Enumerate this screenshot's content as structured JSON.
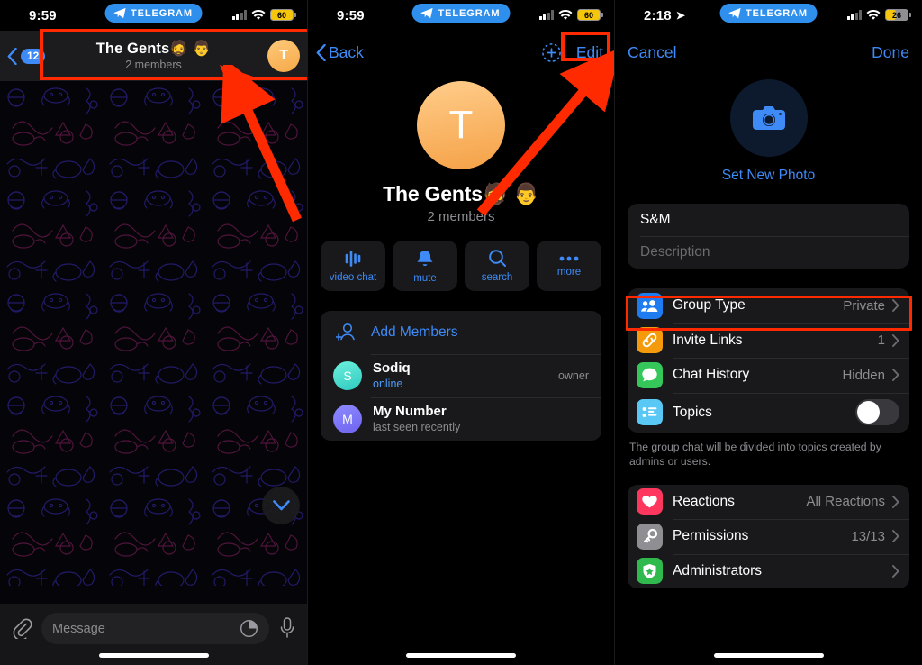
{
  "panel1": {
    "status": {
      "time": "9:59",
      "brand": "TELEGRAM",
      "battery": "60"
    },
    "nav": {
      "back_badge": "12",
      "title": "The Gents🧔 👨",
      "subtitle": "2 members",
      "avatar_letter": "T"
    },
    "composer": {
      "placeholder": "Message"
    }
  },
  "panel2": {
    "status": {
      "time": "9:59",
      "brand": "TELEGRAM",
      "battery": "60"
    },
    "nav": {
      "back_label": "Back",
      "edit_label": "Edit"
    },
    "profile": {
      "avatar_letter": "T",
      "name": "The Gents🧔 👨",
      "subtitle": "2 members"
    },
    "actions": [
      {
        "label": "video chat",
        "icon": "waveform-icon"
      },
      {
        "label": "mute",
        "icon": "bell-icon"
      },
      {
        "label": "search",
        "icon": "magnifier-icon"
      },
      {
        "label": "more",
        "icon": "ellipsis-icon"
      }
    ],
    "members": {
      "add_label": "Add Members",
      "list": [
        {
          "avatar_letter": "S",
          "name": "Sodiq",
          "status": "online",
          "role": "owner"
        },
        {
          "avatar_letter": "M",
          "name": "My Number",
          "status": "last seen recently",
          "role": ""
        }
      ]
    }
  },
  "panel3": {
    "status": {
      "time": "2:18",
      "brand": "TELEGRAM",
      "battery": "26"
    },
    "nav": {
      "cancel_label": "Cancel",
      "done_label": "Done"
    },
    "photo": {
      "label": "Set New Photo",
      "icon": "camera-icon"
    },
    "fields": {
      "group_name": "S&M",
      "description_placeholder": "Description"
    },
    "settings_group_1": [
      {
        "label": "Group Type",
        "value": "Private",
        "icon": "people-icon",
        "icon_color": "#1f7bf0",
        "has_chevron": true
      },
      {
        "label": "Invite Links",
        "value": "1",
        "icon": "link-icon",
        "icon_color": "#f59b0b",
        "has_chevron": true
      },
      {
        "label": "Chat History",
        "value": "Hidden",
        "icon": "chat-bubble-icon",
        "icon_color": "#35c759",
        "has_chevron": true
      },
      {
        "label": "Topics",
        "value": "",
        "icon": "list-icon",
        "icon_color": "#5ac8f5",
        "toggle": "off"
      }
    ],
    "footnote": "The group chat will be divided into topics created by admins or users.",
    "settings_group_2": [
      {
        "label": "Reactions",
        "value": "All Reactions",
        "icon": "heart-icon",
        "icon_color": "#ff375f",
        "has_chevron": true
      },
      {
        "label": "Permissions",
        "value": "13/13",
        "icon": "key-icon",
        "icon_color": "#8e8e93",
        "has_chevron": true
      },
      {
        "label": "Administrators",
        "value": "",
        "icon": "shield-star-icon",
        "icon_color": "#30b94d",
        "has_chevron": true
      }
    ]
  },
  "annotations": {
    "accent": "#ff2a00",
    "highlights": [
      "chat-header-box",
      "edit-button-box",
      "invite-links-row-box"
    ],
    "arrows": [
      "arrow-to-chat-header",
      "arrow-to-edit-button"
    ]
  }
}
